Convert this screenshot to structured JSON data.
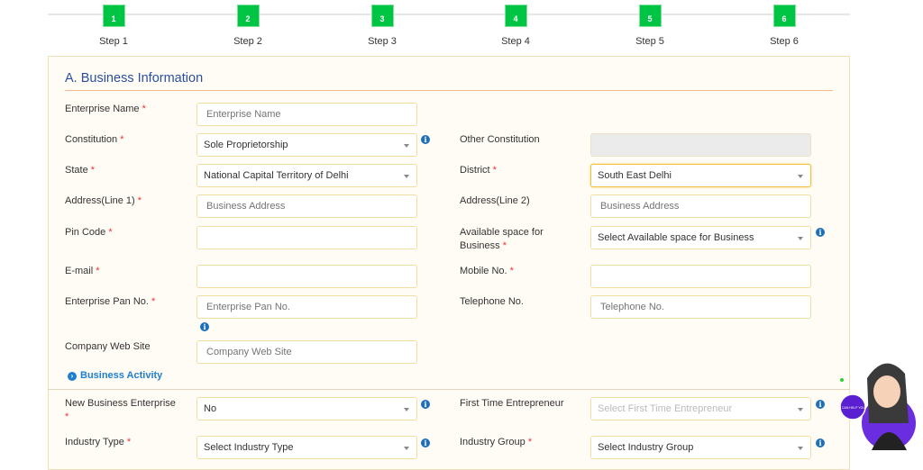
{
  "steps": [
    {
      "num": "1",
      "label": "Step 1"
    },
    {
      "num": "2",
      "label": "Step 2"
    },
    {
      "num": "3",
      "label": "Step 3"
    },
    {
      "num": "4",
      "label": "Step 4"
    },
    {
      "num": "5",
      "label": "Step 5"
    },
    {
      "num": "6",
      "label": "Step 6"
    }
  ],
  "section_title": "A. Business Information",
  "required_mark": "*",
  "fields": {
    "enterprise_name": {
      "label": "Enterprise Name",
      "placeholder": "Enterprise Name"
    },
    "constitution": {
      "label": "Constitution",
      "value": "Sole Proprietorship"
    },
    "other_constitution": {
      "label": "Other Constitution"
    },
    "state": {
      "label": "State",
      "value": "National Capital Territory of Delhi"
    },
    "district": {
      "label": "District",
      "value": "South East Delhi"
    },
    "address1": {
      "label": "Address(Line 1)",
      "placeholder": "Business Address"
    },
    "address2": {
      "label": "Address(Line 2)",
      "placeholder": "Business Address"
    },
    "pin": {
      "label": "Pin Code"
    },
    "space": {
      "label1": "Available space for",
      "label2": "Business",
      "value": "Select Available space for Business"
    },
    "email": {
      "label": "E-mail"
    },
    "mobile": {
      "label": "Mobile No."
    },
    "pan": {
      "label": "Enterprise Pan No.",
      "placeholder": "Enterprise Pan No."
    },
    "telephone": {
      "label": "Telephone No.",
      "placeholder": "Telephone No."
    },
    "website": {
      "label": "Company Web Site",
      "placeholder": "Company Web Site"
    },
    "new_business": {
      "label": "New Business Enterprise",
      "value": "No"
    },
    "first_time": {
      "label": "First Time Entrepreneur",
      "value": "Select First Time Entrepreneur"
    },
    "industry_type": {
      "label": "Industry Type",
      "value": "Select Industry Type"
    },
    "industry_group": {
      "label": "Industry Group",
      "value": "Select Industry Group"
    }
  },
  "business_activity": "Business Activity",
  "avatar_text": "I CAN HELP YOU"
}
